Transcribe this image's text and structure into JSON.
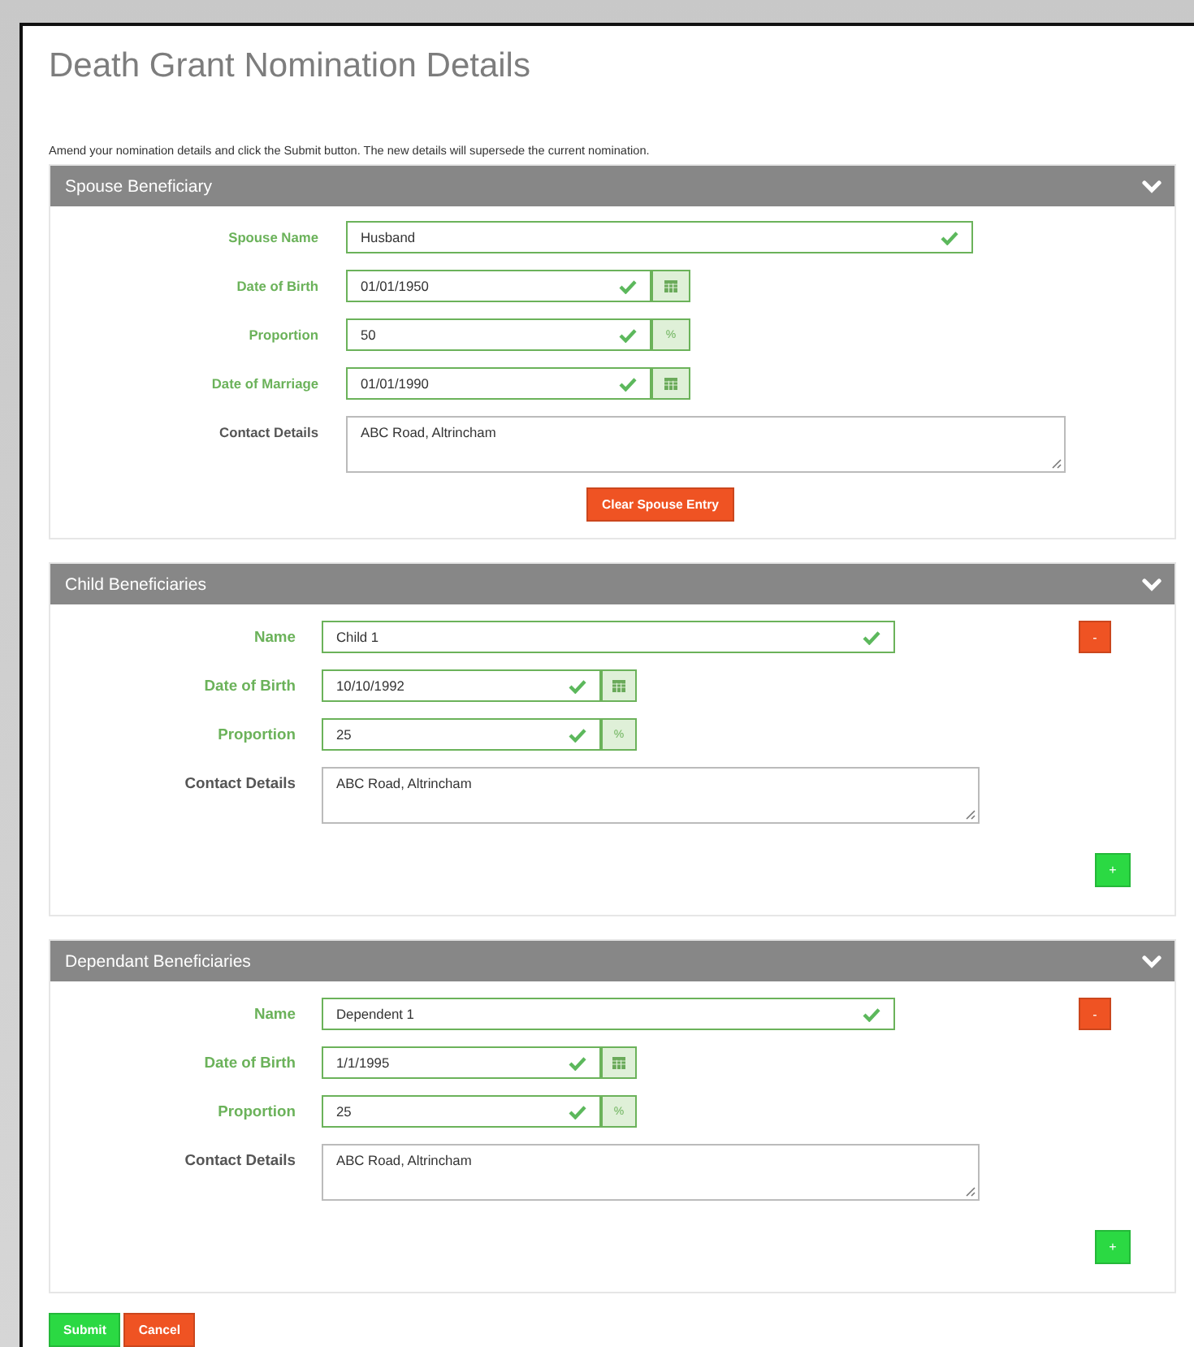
{
  "title": "Death Grant Nomination Details",
  "instructions": "Amend your nomination details and click the Submit button. The new details will supersede the current nomination.",
  "sections": [
    {
      "kind": "spouse",
      "title": "Spouse Beneficiary",
      "expanded": true,
      "fields": [
        {
          "label": "Spouse Name",
          "value": "Husband",
          "valid": true,
          "kind": "text"
        },
        {
          "label": "Date of Birth",
          "value": "01/01/1950",
          "valid": true,
          "kind": "date"
        },
        {
          "label": "Proportion",
          "value": "50",
          "valid": true,
          "kind": "percent",
          "addon": "%"
        },
        {
          "label": "Date of Marriage",
          "value": "01/01/1990",
          "valid": true,
          "kind": "date"
        },
        {
          "label": "Contact Details",
          "value": "ABC Road, Altrincham",
          "valid": false,
          "kind": "textarea"
        }
      ],
      "clear_button": "Clear Spouse Entry"
    },
    {
      "kind": "repeating",
      "title": "Child Beneficiaries",
      "expanded": true,
      "fields": [
        {
          "label": "Name",
          "value": "Child 1",
          "valid": true,
          "kind": "text"
        },
        {
          "label": "Date of Birth",
          "value": "10/10/1992",
          "valid": true,
          "kind": "date"
        },
        {
          "label": "Proportion",
          "value": "25",
          "valid": true,
          "kind": "percent",
          "addon": "%"
        },
        {
          "label": "Contact Details",
          "value": "ABC Road, Altrincham",
          "valid": false,
          "kind": "textarea"
        }
      ],
      "remove_button": "-",
      "add_button": "+"
    },
    {
      "kind": "repeating",
      "title": "Dependant Beneficiaries",
      "expanded": true,
      "fields": [
        {
          "label": "Name",
          "value": "Dependent 1",
          "valid": true,
          "kind": "text"
        },
        {
          "label": "Date of Birth",
          "value": "1/1/1995",
          "valid": true,
          "kind": "date"
        },
        {
          "label": "Proportion",
          "value": "25",
          "valid": true,
          "kind": "percent",
          "addon": "%"
        },
        {
          "label": "Contact Details",
          "value": "ABC Road, Altrincham",
          "valid": false,
          "kind": "textarea"
        }
      ],
      "remove_button": "-",
      "add_button": "+"
    }
  ],
  "submit_button": "Submit",
  "cancel_button": "Cancel"
}
